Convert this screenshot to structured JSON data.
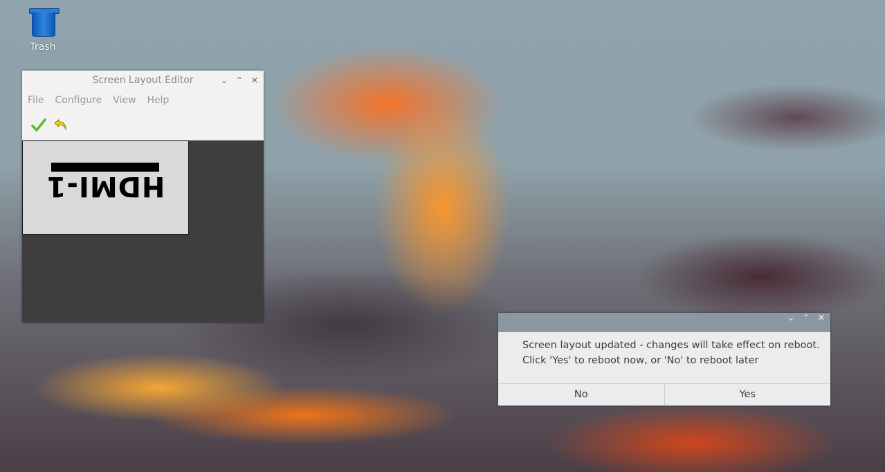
{
  "desktop": {
    "trash_label": "Trash"
  },
  "editor": {
    "title": "Screen Layout Editor",
    "controls": {
      "minimize": "⌄",
      "maximize": "⌃",
      "close": "✕"
    },
    "menu": [
      "File",
      "Configure",
      "View",
      "Help"
    ],
    "toolbar": {
      "apply_icon": "checkmark-icon",
      "undo_icon": "undo-arrow-icon"
    },
    "monitor_label": "HDMI-1"
  },
  "dialog": {
    "controls": {
      "minimize": "⌄",
      "maximize": "⌃",
      "close": "✕"
    },
    "message_line1": "Screen layout updated - changes will take effect on reboot.",
    "message_line2": "Click 'Yes' to reboot now, or 'No' to reboot later",
    "no_label": "No",
    "yes_label": "Yes"
  },
  "colors": {
    "dialog_titlebar": "#8c98a1",
    "editor_canvas": "#3e3e3e",
    "apply_green": "#5cb82e",
    "undo_yellow": "#e8c20f"
  }
}
